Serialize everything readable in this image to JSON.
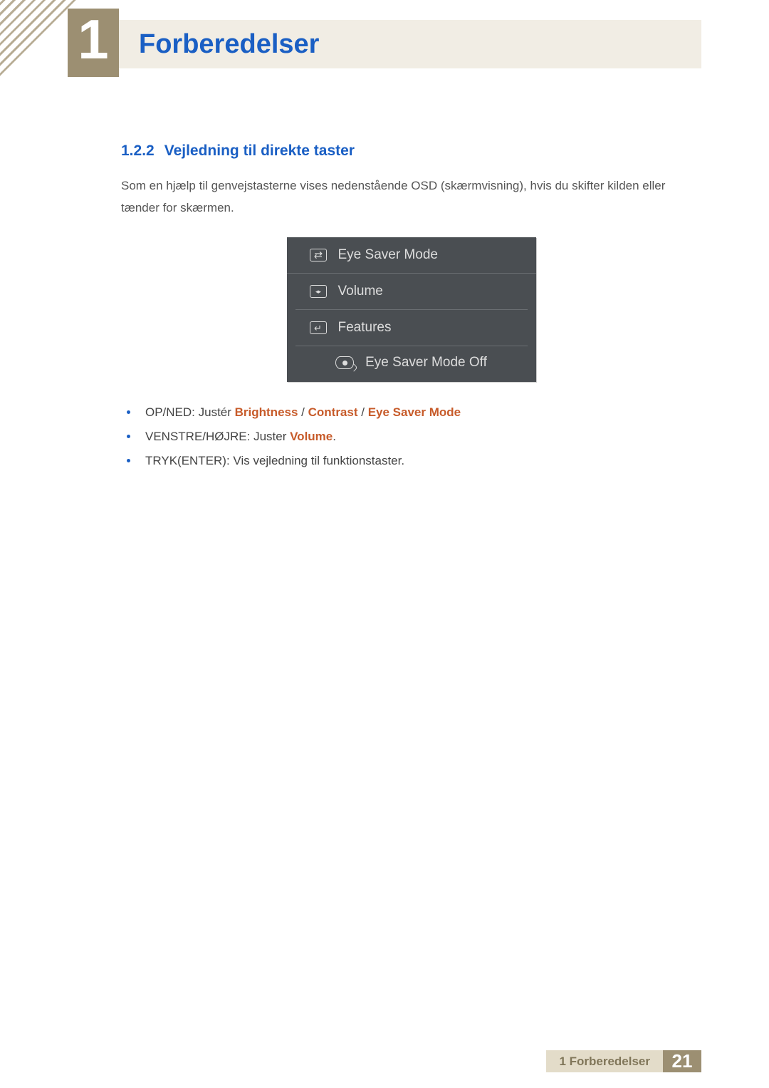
{
  "chapter": {
    "number": "1",
    "title": "Forberedelser"
  },
  "section": {
    "number": "1.2.2",
    "title": "Vejledning til direkte taster"
  },
  "intro": "Som en hjælp til genvejstasterne vises nedenstående OSD (skærmvisning), hvis du skifter kilden eller tænder for skærmen.",
  "osd": {
    "row1": "Eye Saver Mode",
    "row2": "Volume",
    "row3": "Features",
    "status": "Eye Saver Mode Off"
  },
  "bullets": {
    "b1_pre": "OP/NED: Justér ",
    "b1_h1": "Brightness",
    "b1_h2": "Contrast",
    "b1_h3": "Eye Saver Mode",
    "b2_pre": "VENSTRE/HØJRE: Juster ",
    "b2_h1": "Volume",
    "b2_post": ".",
    "b3": "TRYK(ENTER): Vis vejledning til funktionstaster."
  },
  "sep": " / ",
  "footer": {
    "label": "1 Forberedelser",
    "page": "21"
  }
}
